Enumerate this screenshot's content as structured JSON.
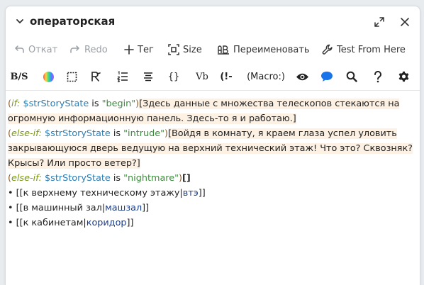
{
  "panel": {
    "title": "операторская"
  },
  "toolbar1": [
    {
      "label": "Откат",
      "icon": "undo-icon"
    },
    {
      "label": "Redo",
      "icon": "redo-icon"
    },
    {
      "label": "Тег",
      "icon": "plus-icon"
    },
    {
      "label": "Size",
      "icon": "size-icon"
    },
    {
      "label": "Переименовать",
      "icon": "rename-icon"
    },
    {
      "label": "Test From Here",
      "icon": "wrench-icon"
    }
  ],
  "toolbar2": {
    "strike_label": "B/S",
    "braces_label": "{}",
    "vb_label": "Vb",
    "comment_label": "(!-",
    "macro_label": "(Macro:)"
  },
  "code": {
    "l1": {
      "open": "(",
      "macro": "if:",
      "var": " $strStoryState",
      "op": " is ",
      "str": "\"begin\"",
      "close": ")",
      "text": "[Здесь данные с множества телескопов стекаются на"
    },
    "l2": {
      "text": "огромную информационную панель. Здесь-то я и работаю.]"
    },
    "l3": {
      "open": "(",
      "macro": "else-if:",
      "var": " $strStoryState",
      "op": " is ",
      "str": "\"intrude\"",
      "close": ")",
      "text": "[Войдя в комнату, я краем глаза успел уловить"
    },
    "l4": {
      "text": "закрывающуюся дверь ведущую на верхний технический этаж! Что это? Сквозняк?"
    },
    "l5": {
      "text": "Крысы? Или просто ветер?]"
    },
    "l6": {
      "open": "(",
      "macro": "else-if:",
      "var": " $strStoryState",
      "op": " is ",
      "str": "\"nightmare\"",
      "close": ")",
      "text": "[]"
    },
    "links": [
      {
        "bullet": "• ",
        "open": "[[",
        "text": "к верхнему техническому этажу",
        "sep": "|",
        "target": "втэ",
        "close": "]]"
      },
      {
        "bullet": "• ",
        "open": "[[",
        "text": "в машинный зал",
        "sep": "|",
        "target": "машзал",
        "close": "]]"
      },
      {
        "bullet": "• ",
        "open": "[[",
        "text": "к кабинетам",
        "sep": "|",
        "target": "коридор",
        "close": "]]"
      }
    ]
  },
  "colors": {
    "macro": "#7a9a12",
    "variable": "#2a7db5",
    "string": "#3a8f3a",
    "hook_bg": "#fdf1e4",
    "link_target": "#1a3c8c",
    "comment_icon": "#1a73e8"
  }
}
